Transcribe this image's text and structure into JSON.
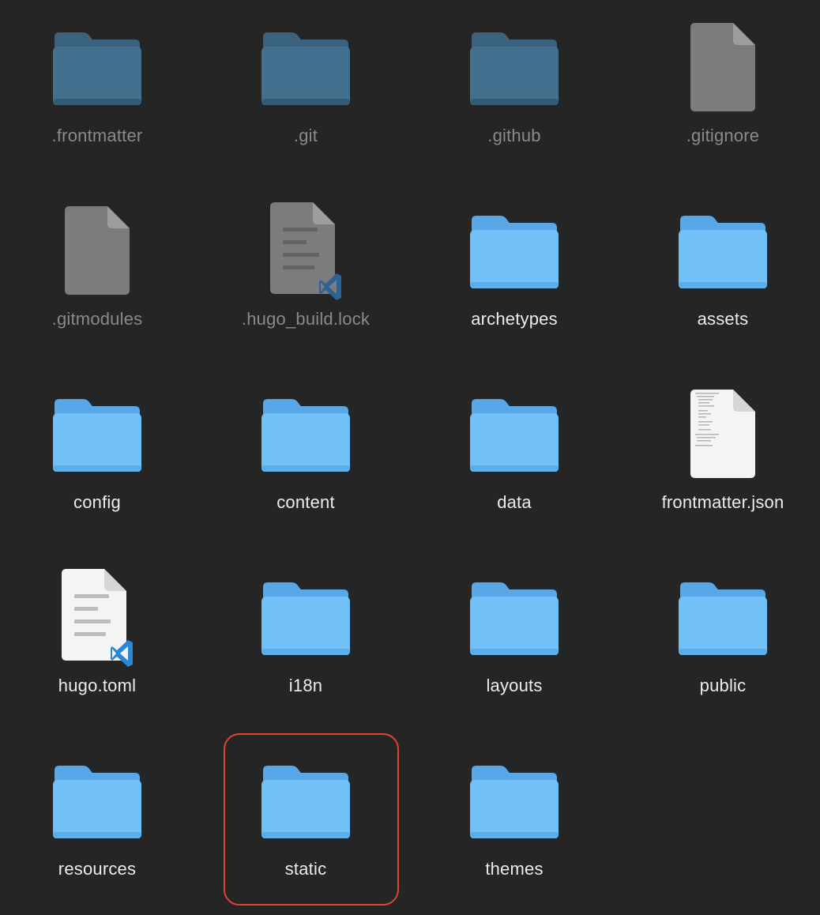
{
  "colors": {
    "background": "#252525",
    "folder_front": "#72c0f7",
    "folder_back": "#58a8e8",
    "folder_hidden_front": "#4a7ea3",
    "folder_hidden_back": "#3e6c8e",
    "label": "#ececec",
    "label_hidden": "#8a8a8a",
    "highlight": "#e0442f"
  },
  "items": [
    {
      "name": ".frontmatter",
      "kind": "folder",
      "hidden": true
    },
    {
      "name": ".git",
      "kind": "folder",
      "hidden": true
    },
    {
      "name": ".github",
      "kind": "folder",
      "hidden": true
    },
    {
      "name": ".gitignore",
      "kind": "file-blank",
      "hidden": true
    },
    {
      "name": ".gitmodules",
      "kind": "file-blank",
      "hidden": true
    },
    {
      "name": ".hugo_build.lock",
      "kind": "file-vscode",
      "hidden": true
    },
    {
      "name": "archetypes",
      "kind": "folder",
      "hidden": false
    },
    {
      "name": "assets",
      "kind": "folder",
      "hidden": false
    },
    {
      "name": "config",
      "kind": "folder",
      "hidden": false
    },
    {
      "name": "content",
      "kind": "folder",
      "hidden": false
    },
    {
      "name": "data",
      "kind": "folder",
      "hidden": false
    },
    {
      "name": "frontmatter.json",
      "kind": "file-text",
      "hidden": false
    },
    {
      "name": "hugo.toml",
      "kind": "file-vscode",
      "hidden": false
    },
    {
      "name": "i18n",
      "kind": "folder",
      "hidden": false
    },
    {
      "name": "layouts",
      "kind": "folder",
      "hidden": false
    },
    {
      "name": "public",
      "kind": "folder",
      "hidden": false
    },
    {
      "name": "resources",
      "kind": "folder",
      "hidden": false
    },
    {
      "name": "static",
      "kind": "folder",
      "hidden": false,
      "selected": true
    },
    {
      "name": "themes",
      "kind": "folder",
      "hidden": false
    }
  ]
}
